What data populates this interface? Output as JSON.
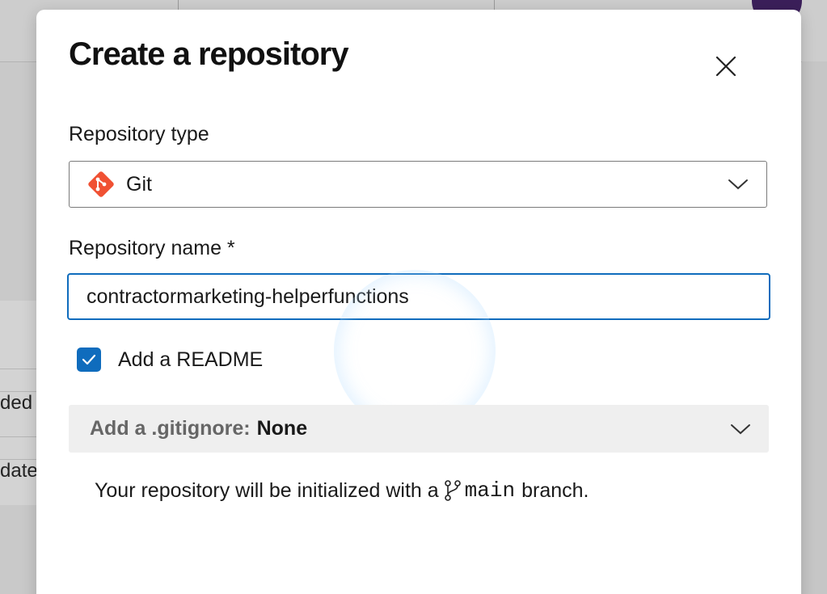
{
  "background": {
    "cells": [
      "ded",
      "date"
    ]
  },
  "dialog": {
    "title": "Create a repository",
    "close_icon": "close-icon",
    "repo_type": {
      "label": "Repository type",
      "value": "Git",
      "icon": "git-icon"
    },
    "repo_name": {
      "label": "Repository name *",
      "value": "contractormarketing-helperfunctions"
    },
    "readme": {
      "label": "Add a README",
      "checked": true
    },
    "gitignore": {
      "label": "Add a .gitignore:",
      "value": "None"
    },
    "info": {
      "prefix": "Your repository will be initialized with a",
      "branch": "main",
      "suffix": "branch."
    }
  },
  "colors": {
    "accent": "#0f6cbd",
    "git": "#f05133"
  }
}
